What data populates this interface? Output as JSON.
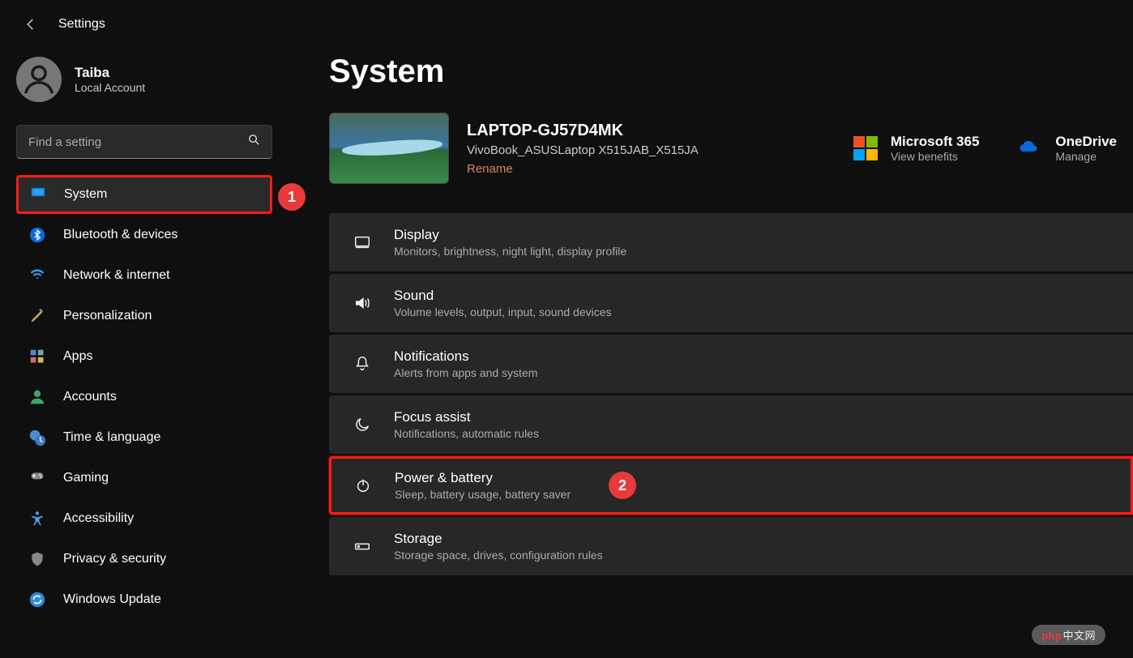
{
  "header": {
    "title": "Settings"
  },
  "account": {
    "name": "Taiba",
    "sub": "Local Account"
  },
  "search": {
    "placeholder": "Find a setting"
  },
  "nav": [
    {
      "label": "System",
      "icon": "monitor",
      "active": true,
      "highlight": true
    },
    {
      "label": "Bluetooth & devices",
      "icon": "bluetooth"
    },
    {
      "label": "Network & internet",
      "icon": "wifi"
    },
    {
      "label": "Personalization",
      "icon": "brush"
    },
    {
      "label": "Apps",
      "icon": "apps"
    },
    {
      "label": "Accounts",
      "icon": "person"
    },
    {
      "label": "Time & language",
      "icon": "clock-globe"
    },
    {
      "label": "Gaming",
      "icon": "gamepad"
    },
    {
      "label": "Accessibility",
      "icon": "accessibility"
    },
    {
      "label": "Privacy & security",
      "icon": "shield"
    },
    {
      "label": "Windows Update",
      "icon": "update"
    }
  ],
  "callouts": {
    "one": "1",
    "two": "2"
  },
  "page": {
    "title": "System"
  },
  "device": {
    "name": "LAPTOP-GJ57D4MK",
    "model": "VivoBook_ASUSLaptop X515JAB_X515JA",
    "rename": "Rename"
  },
  "promo": {
    "ms365": {
      "title": "Microsoft 365",
      "sub": "View benefits"
    },
    "onedrive": {
      "title": "OneDrive",
      "sub": "Manage"
    }
  },
  "settings_items": [
    {
      "title": "Display",
      "sub": "Monitors, brightness, night light, display profile",
      "icon": "display"
    },
    {
      "title": "Sound",
      "sub": "Volume levels, output, input, sound devices",
      "icon": "sound"
    },
    {
      "title": "Notifications",
      "sub": "Alerts from apps and system",
      "icon": "bell"
    },
    {
      "title": "Focus assist",
      "sub": "Notifications, automatic rules",
      "icon": "moon"
    },
    {
      "title": "Power & battery",
      "sub": "Sleep, battery usage, battery saver",
      "icon": "power",
      "highlight": true
    },
    {
      "title": "Storage",
      "sub": "Storage space, drives, configuration rules",
      "icon": "storage"
    }
  ],
  "watermark": {
    "brand": "php",
    "suffix": "中文网"
  }
}
